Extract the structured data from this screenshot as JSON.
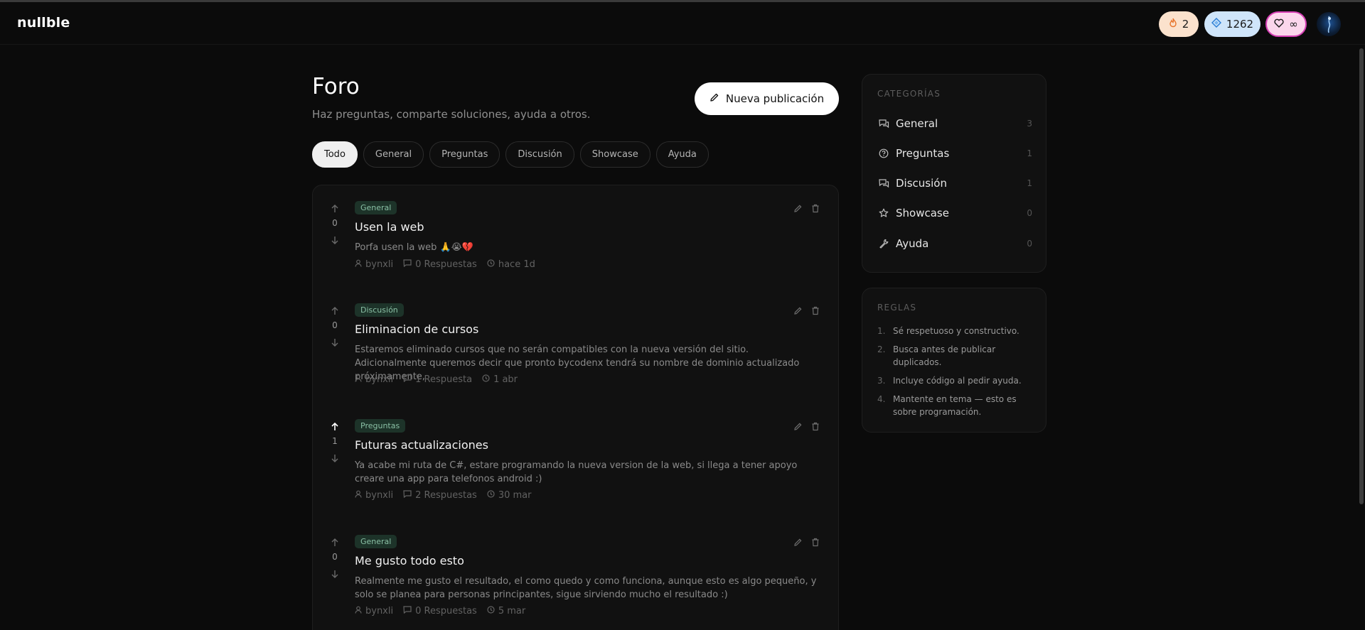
{
  "app": {
    "logo": "nullble"
  },
  "header": {
    "streak": {
      "value": "2",
      "icon": "flame-icon"
    },
    "gems": {
      "value": "1262",
      "icon": "diamond-icon"
    },
    "lives": {
      "value": "∞",
      "icon": "heart-icon"
    },
    "avatar": "user-avatar"
  },
  "page": {
    "title": "Foro",
    "subtitle": "Haz preguntas, comparte soluciones, ayuda a otros.",
    "new_post_label": "Nueva publicación"
  },
  "filters": [
    {
      "label": "Todo",
      "active": true
    },
    {
      "label": "General",
      "active": false
    },
    {
      "label": "Preguntas",
      "active": false
    },
    {
      "label": "Discusión",
      "active": false
    },
    {
      "label": "Showcase",
      "active": false
    },
    {
      "label": "Ayuda",
      "active": false
    }
  ],
  "posts": [
    {
      "votes": "0",
      "upvoted": false,
      "category": "General",
      "title": "Usen la web",
      "body": "Porfa usen la web 🙏😭💔",
      "author": "bynxli",
      "replies": "0 Respuestas",
      "time": "hace 1d"
    },
    {
      "votes": "0",
      "upvoted": false,
      "category": "Discusión",
      "title": "Eliminacion de cursos",
      "body": "Estaremos eliminado cursos que no serán compatibles con la nueva versión del sitio. Adicionalmente queremos decir que pronto bycodenx tendrá su nombre de dominio actualizado próximamente,",
      "author": "bynxli",
      "replies": "1 Respuesta",
      "time": "1 abr"
    },
    {
      "votes": "1",
      "upvoted": true,
      "category": "Preguntas",
      "title": "Futuras actualizaciones",
      "body": "Ya acabe mi ruta de C#, estare programando la nueva version de la web, si llega a tener apoyo creare una app para telefonos android :)",
      "author": "bynxli",
      "replies": "2 Respuestas",
      "time": "30 mar"
    },
    {
      "votes": "0",
      "upvoted": false,
      "category": "General",
      "title": "Me gusto todo esto",
      "body": "Realmente me gusto el resultado, el como quedo y como funciona, aunque esto es algo pequeño, y solo se planea para personas principantes, sigue sirviendo mucho el resultado :)",
      "author": "bynxli",
      "replies": "0 Respuestas",
      "time": "5 mar"
    }
  ],
  "categories": {
    "heading": "CATEGORÍAS",
    "items": [
      {
        "name": "General",
        "count": "3",
        "icon": "chat-bubbles-icon"
      },
      {
        "name": "Preguntas",
        "count": "1",
        "icon": "question-circle-icon"
      },
      {
        "name": "Discusión",
        "count": "1",
        "icon": "chat-bubbles-icon"
      },
      {
        "name": "Showcase",
        "count": "0",
        "icon": "star-icon"
      },
      {
        "name": "Ayuda",
        "count": "0",
        "icon": "wrench-icon"
      }
    ]
  },
  "rules": {
    "heading": "REGLAS",
    "items": [
      {
        "num": "1.",
        "text": "Sé respetuoso y constructivo."
      },
      {
        "num": "2.",
        "text": "Busca antes de publicar duplicados."
      },
      {
        "num": "3.",
        "text": "Incluye código al pedir ayuda."
      },
      {
        "num": "4.",
        "text": "Mantente en tema — esto es sobre programación."
      }
    ]
  }
}
